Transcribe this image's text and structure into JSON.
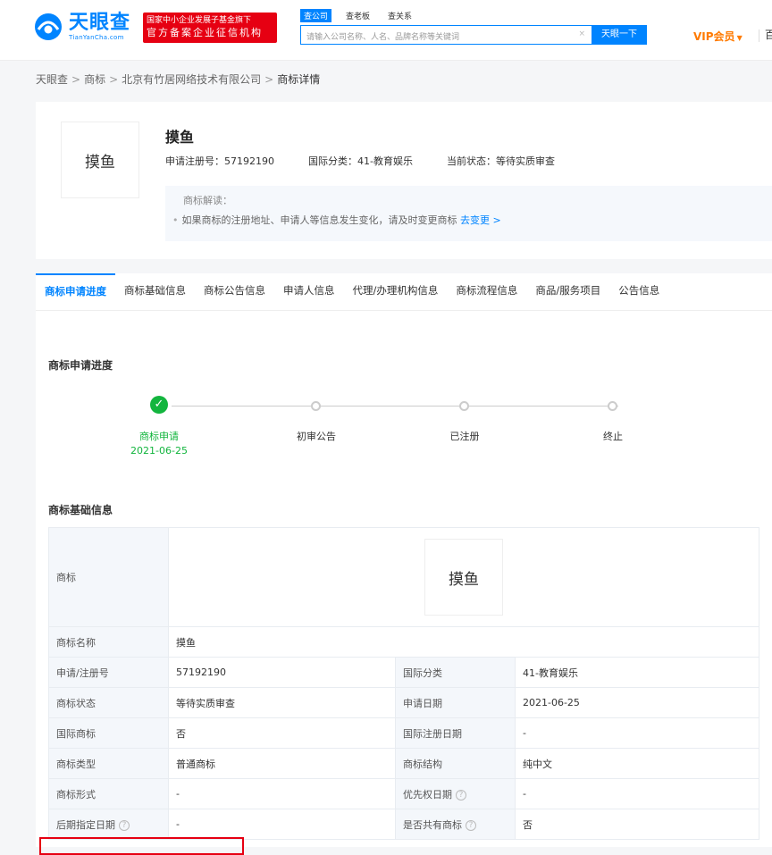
{
  "header": {
    "logo_cn": "天眼查",
    "logo_en": "TianYanCha.com",
    "badge_line1": "国家中小企业发展子基金旗下",
    "badge_line2": "官方备案企业征信机构",
    "search_tabs": [
      "查公司",
      "查老板",
      "查关系"
    ],
    "search_placeholder": "请输入公司名称、人名、品牌名称等关键词",
    "search_clear": "×",
    "search_button": "天眼一下",
    "vip_label": "VIP会员",
    "vip_arrow": "▼",
    "more": "百"
  },
  "breadcrumb": {
    "items": [
      "天眼查",
      "商标",
      "北京有竹居网络技术有限公司"
    ],
    "current": "商标详情",
    "separator": ">"
  },
  "summary": {
    "thumb_text": "摸鱼",
    "name": "摸鱼",
    "reg_no": "申请注册号：57192190",
    "intl_class": "国际分类：41-教育娱乐",
    "status": "当前状态：等待实质审查",
    "interp_title": "商标解读：",
    "interp_text": "如果商标的注册地址、申请人等信息发生变化，请及时变更商标",
    "interp_link": "去变更 >"
  },
  "tabs": [
    "商标申请进度",
    "商标基础信息",
    "商标公告信息",
    "申请人信息",
    "代理/办理机构信息",
    "商标流程信息",
    "商品/服务项目",
    "公告信息"
  ],
  "progress": {
    "title": "商标申请进度",
    "steps": [
      {
        "label": "商标申请",
        "date": "2021-06-25",
        "done": true
      },
      {
        "label": "初审公告",
        "date": "",
        "done": false
      },
      {
        "label": "已注册",
        "date": "",
        "done": false
      },
      {
        "label": "终止",
        "date": "",
        "done": false
      }
    ],
    "check": "✓"
  },
  "basic_info": {
    "title": "商标基础信息",
    "trademark_label": "商标",
    "trademark_image_text": "摸鱼",
    "name_label": "商标名称",
    "name_value": "摸鱼",
    "rows": [
      {
        "k1": "申请/注册号",
        "v1": "57192190",
        "k2": "国际分类",
        "v2": "41-教育娱乐",
        "h1": false,
        "h2": false
      },
      {
        "k1": "商标状态",
        "v1": "等待实质审查",
        "k2": "申请日期",
        "v2": "2021-06-25",
        "h1": false,
        "h2": false
      },
      {
        "k1": "国际商标",
        "v1": "否",
        "k2": "国际注册日期",
        "v2": "-",
        "h1": false,
        "h2": false
      },
      {
        "k1": "商标类型",
        "v1": "普通商标",
        "k2": "商标结构",
        "v2": "纯中文",
        "h1": false,
        "h2": false
      },
      {
        "k1": "商标形式",
        "v1": "-",
        "k2": "优先权日期",
        "v2": "-",
        "h1": false,
        "h2": true
      },
      {
        "k1": "后期指定日期",
        "v1": "-",
        "k2": "是否共有商标",
        "v2": "否",
        "h1": true,
        "h2": true
      }
    ],
    "help_icon": "?"
  },
  "colors": {
    "brand": "#0084ff",
    "done": "#13b53e",
    "badge": "#e60012",
    "vip": "#ff7a00"
  }
}
